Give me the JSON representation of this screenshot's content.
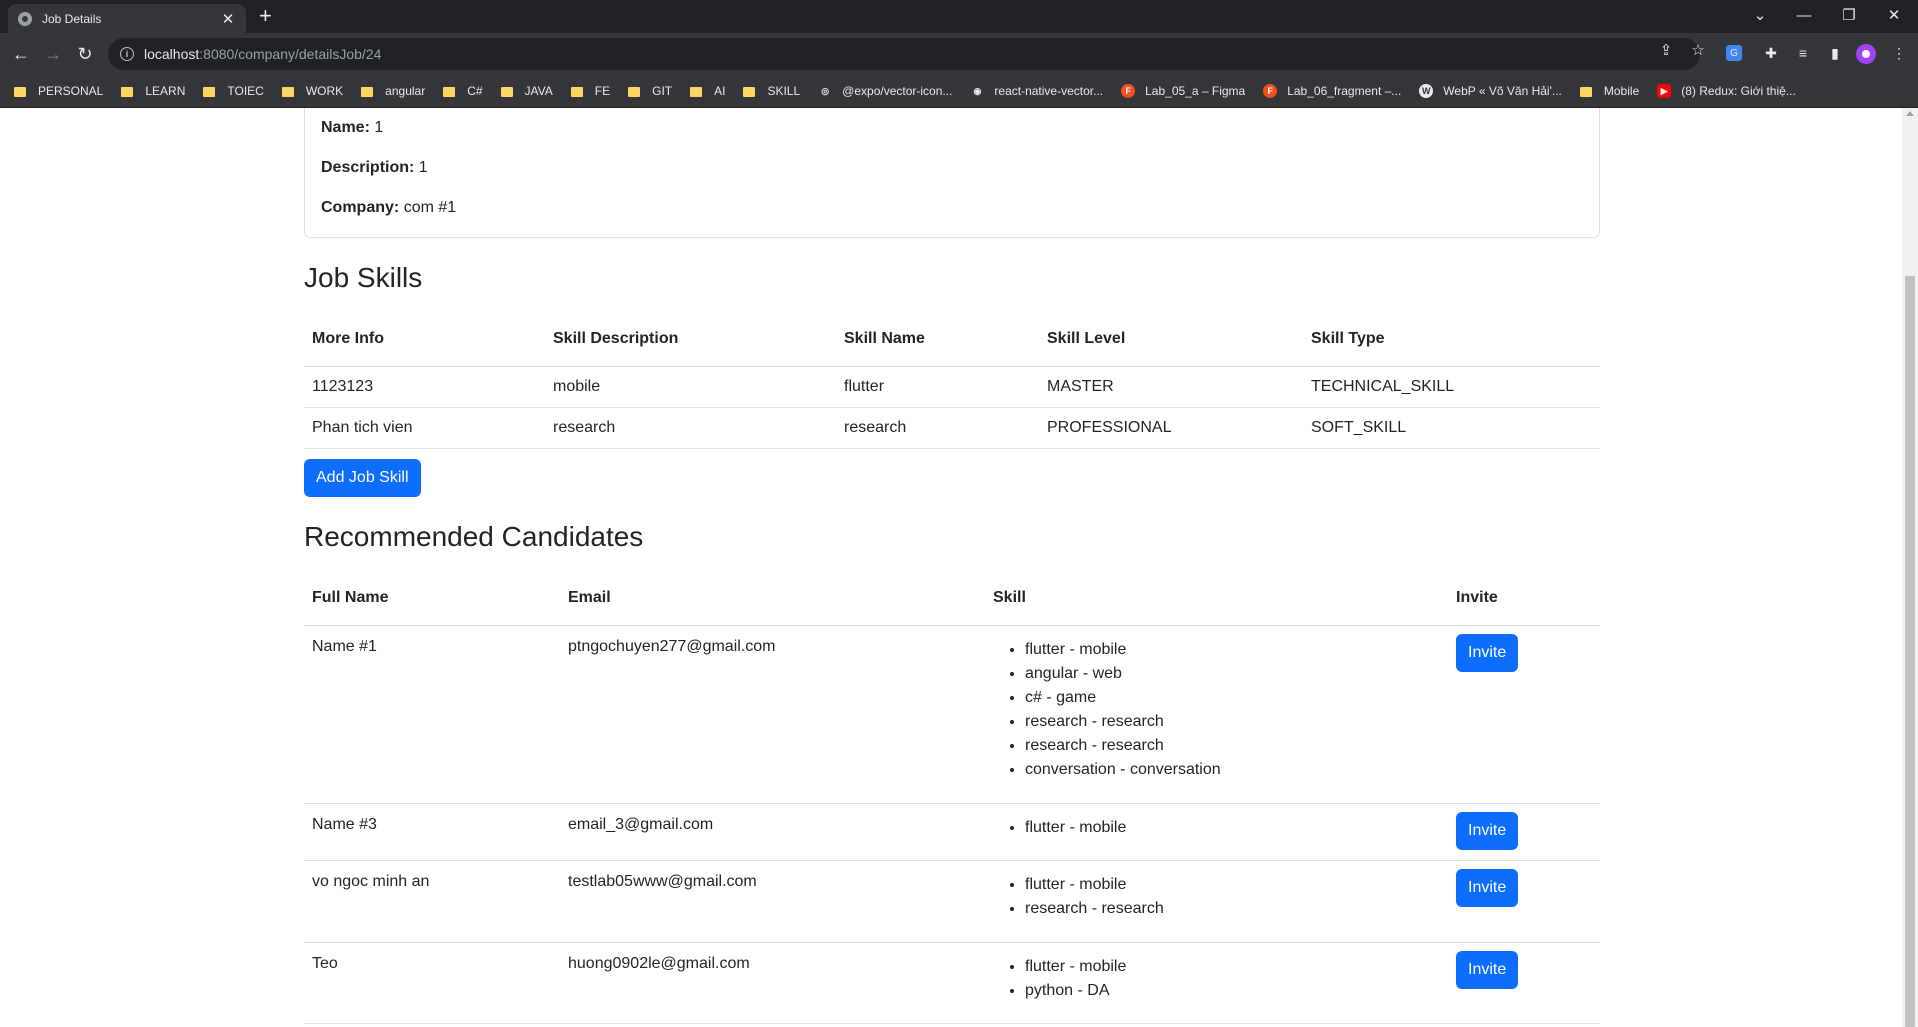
{
  "browser": {
    "tab_title": "Job Details",
    "url_host": "localhost",
    "url_path": ":8080/company/detailsJob/24",
    "bookmarks": [
      {
        "label": "PERSONAL",
        "icon": "folder"
      },
      {
        "label": "LEARN",
        "icon": "folder"
      },
      {
        "label": "TOIEC",
        "icon": "folder"
      },
      {
        "label": "WORK",
        "icon": "folder"
      },
      {
        "label": "angular",
        "icon": "folder"
      },
      {
        "label": "C#",
        "icon": "folder"
      },
      {
        "label": "JAVA",
        "icon": "folder"
      },
      {
        "label": "FE",
        "icon": "folder"
      },
      {
        "label": "GIT",
        "icon": "folder"
      },
      {
        "label": "AI",
        "icon": "folder"
      },
      {
        "label": "SKILL",
        "icon": "folder"
      },
      {
        "label": "@expo/vector-icon...",
        "icon": "expo"
      },
      {
        "label": "react-native-vector...",
        "icon": "globe"
      },
      {
        "label": "Lab_05_a – Figma",
        "icon": "figma"
      },
      {
        "label": "Lab_06_fragment –...",
        "icon": "figma"
      },
      {
        "label": "WebP « Võ Văn Hải'...",
        "icon": "wordpress"
      },
      {
        "label": "Mobile",
        "icon": "folder"
      },
      {
        "label": "(8) Redux: Giới thiệ...",
        "icon": "youtube"
      }
    ]
  },
  "job": {
    "name_label": "Name:",
    "name_value": "1",
    "description_label": "Description:",
    "description_value": "1",
    "company_label": "Company:",
    "company_value": "com #1"
  },
  "job_skills": {
    "heading": "Job Skills",
    "columns": [
      "More Info",
      "Skill Description",
      "Skill Name",
      "Skill Level",
      "Skill Type"
    ],
    "rows": [
      [
        "1123123",
        "mobile",
        "flutter",
        "MASTER",
        "TECHNICAL_SKILL"
      ],
      [
        "Phan tich vien",
        "research",
        "research",
        "PROFESSIONAL",
        "SOFT_SKILL"
      ]
    ],
    "add_button": "Add Job Skill"
  },
  "candidates": {
    "heading": "Recommended Candidates",
    "columns": [
      "Full Name",
      "Email",
      "Skill",
      "Invite"
    ],
    "invite_label": "Invite",
    "rows": [
      {
        "name": "Name #1",
        "email": "ptngochuyen277@gmail.com",
        "skills": [
          "flutter - mobile",
          "angular - web",
          "c# - game",
          "research - research",
          "research - research",
          "conversation - conversation"
        ]
      },
      {
        "name": "Name #3",
        "email": "email_3@gmail.com",
        "skills": [
          "flutter - mobile"
        ]
      },
      {
        "name": "vo ngoc minh an",
        "email": "testlab05www@gmail.com",
        "skills": [
          "flutter - mobile",
          "research - research"
        ]
      },
      {
        "name": "Teo",
        "email": "huong0902le@gmail.com",
        "skills": [
          "flutter - mobile",
          "python - DA"
        ]
      }
    ]
  }
}
